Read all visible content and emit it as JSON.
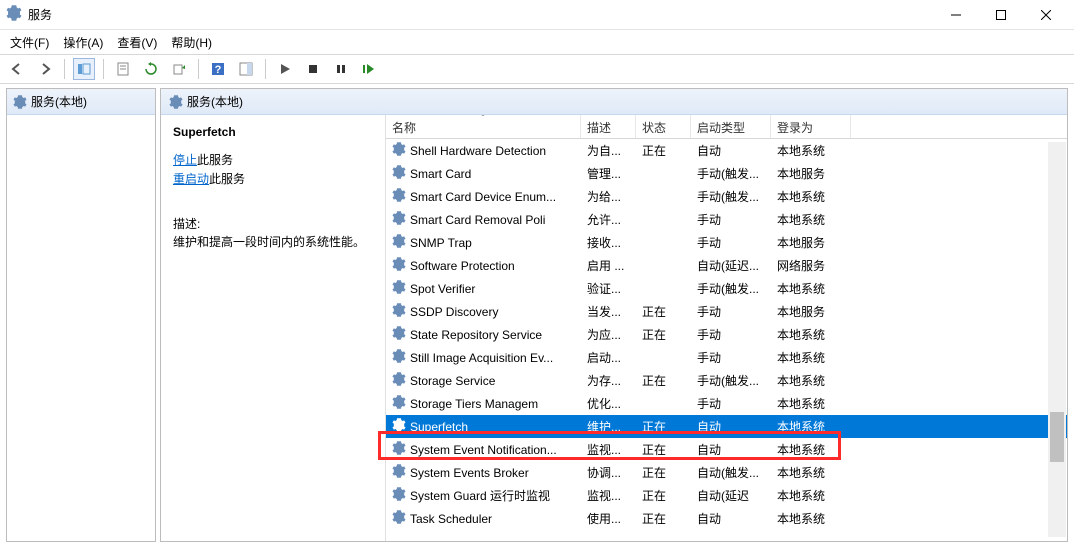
{
  "titlebar": {
    "title": "服务"
  },
  "menubar": {
    "file": "文件(F)",
    "action": "操作(A)",
    "view": "查看(V)",
    "help": "帮助(H)"
  },
  "left_pane": {
    "header": "服务(本地)"
  },
  "right_pane": {
    "tab": "服务(本地)"
  },
  "details": {
    "service_name": "Superfetch",
    "stop_link": "停止",
    "stop_suffix": "此服务",
    "restart_link": "重启动",
    "restart_suffix": "此服务",
    "desc_label": "描述:",
    "desc_text": "维护和提高一段时间内的系统性能。"
  },
  "columns": {
    "name": "名称",
    "desc": "描述",
    "status": "状态",
    "startup": "启动类型",
    "logon": "登录为"
  },
  "services": [
    {
      "name": "Shell Hardware Detection",
      "desc": "为自...",
      "status": "正在",
      "startup": "自动",
      "logon": "本地系统"
    },
    {
      "name": "Smart Card",
      "desc": "管理...",
      "status": "",
      "startup": "手动(触发...",
      "logon": "本地服务"
    },
    {
      "name": "Smart Card Device Enum...",
      "desc": "为给...",
      "status": "",
      "startup": "手动(触发...",
      "logon": "本地系统"
    },
    {
      "name": "Smart Card Removal Poli",
      "desc": "允许...",
      "status": "",
      "startup": "手动",
      "logon": "本地系统"
    },
    {
      "name": "SNMP Trap",
      "desc": "接收...",
      "status": "",
      "startup": "手动",
      "logon": "本地服务"
    },
    {
      "name": "Software Protection",
      "desc": "启用 ...",
      "status": "",
      "startup": "自动(延迟...",
      "logon": "网络服务"
    },
    {
      "name": "Spot Verifier",
      "desc": "验证...",
      "status": "",
      "startup": "手动(触发...",
      "logon": "本地系统"
    },
    {
      "name": "SSDP Discovery",
      "desc": "当发...",
      "status": "正在",
      "startup": "手动",
      "logon": "本地服务"
    },
    {
      "name": "State Repository Service",
      "desc": "为应...",
      "status": "正在",
      "startup": "手动",
      "logon": "本地系统"
    },
    {
      "name": "Still Image Acquisition Ev...",
      "desc": "启动...",
      "status": "",
      "startup": "手动",
      "logon": "本地系统"
    },
    {
      "name": "Storage Service",
      "desc": "为存...",
      "status": "正在",
      "startup": "手动(触发...",
      "logon": "本地系统"
    },
    {
      "name": "Storage Tiers Managem",
      "desc": "优化...",
      "status": "",
      "startup": "手动",
      "logon": "本地系统"
    },
    {
      "name": "Superfetch",
      "desc": "维护...",
      "status": "正在",
      "startup": "自动",
      "logon": "本地系统",
      "selected": true
    },
    {
      "name": "System Event Notification...",
      "desc": "监视...",
      "status": "正在",
      "startup": "自动",
      "logon": "本地系统"
    },
    {
      "name": "System Events Broker",
      "desc": "协调...",
      "status": "正在",
      "startup": "自动(触发...",
      "logon": "本地系统"
    },
    {
      "name": "System Guard 运行时监视",
      "desc": "监视...",
      "status": "正在",
      "startup": "自动(延迟",
      "logon": "本地系统"
    },
    {
      "name": "Task Scheduler",
      "desc": "使用...",
      "status": "正在",
      "startup": "自动",
      "logon": "本地系统"
    }
  ]
}
